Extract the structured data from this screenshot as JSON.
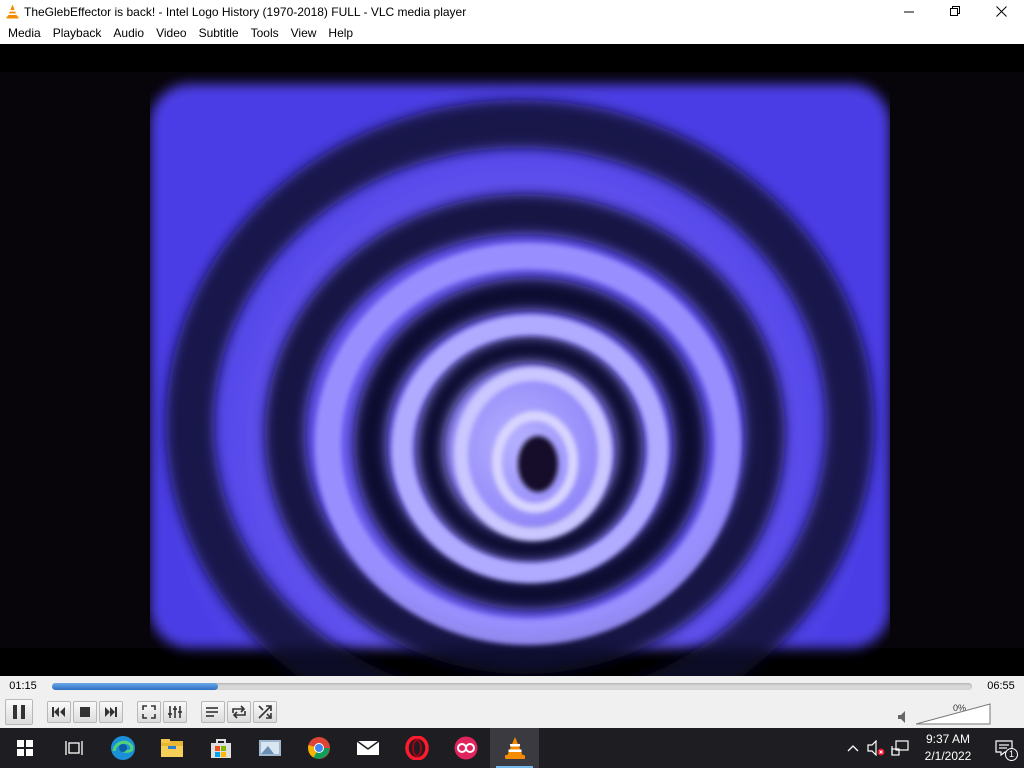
{
  "window": {
    "title": "TheGlebEffector is back! - Intel Logo History (1970-2018) FULL - VLC media player"
  },
  "menu": [
    "Media",
    "Playback",
    "Audio",
    "Video",
    "Subtitle",
    "Tools",
    "View",
    "Help"
  ],
  "player": {
    "elapsed": "01:15",
    "duration": "06:55",
    "progress_fraction": 0.18,
    "volume_label": "0%",
    "volume_fraction": 0.0
  },
  "taskbar": {
    "apps": [
      "start-menu",
      "task-view",
      "microsoft-edge",
      "file-explorer",
      "microsoft-store",
      "photos",
      "google-chrome",
      "mail",
      "opera",
      "app",
      "vlc"
    ],
    "time": "9:37 AM",
    "date": "2/1/2022",
    "notification_count": "1"
  },
  "colors": {
    "spiral": "#5b4df5",
    "seek_fill": "#3b7fd4",
    "taskbar_bg": "#1e1e22",
    "vlc_orange": "#f48b00"
  }
}
